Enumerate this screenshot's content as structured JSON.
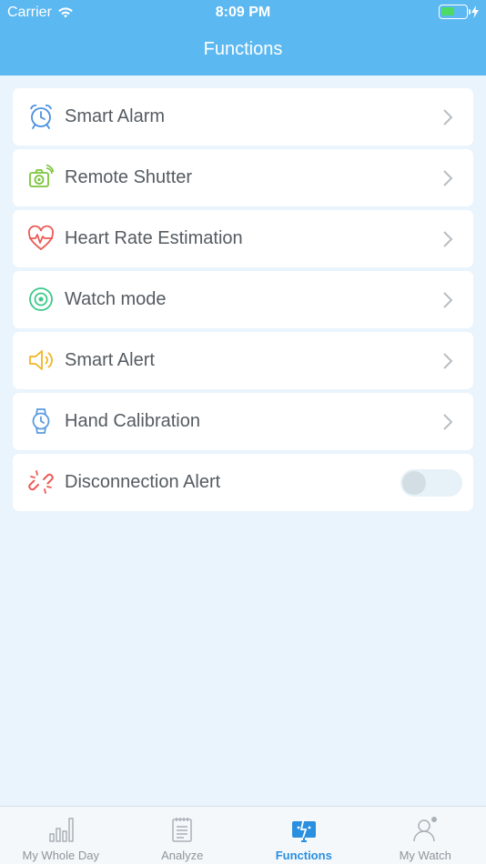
{
  "status_bar": {
    "carrier": "Carrier",
    "time": "8:09 PM",
    "battery_color": "#4cd964"
  },
  "header": {
    "title": "Functions",
    "background": "#5cb8f0"
  },
  "functions": [
    {
      "label": "Smart Alarm",
      "icon": "alarm-clock-icon",
      "color": "#4a8fe0",
      "control": "chevron"
    },
    {
      "label": "Remote Shutter",
      "icon": "camera-icon",
      "color": "#7cc43b",
      "control": "chevron"
    },
    {
      "label": "Heart Rate Estimation",
      "icon": "heart-rate-icon",
      "color": "#ec5a55",
      "control": "chevron"
    },
    {
      "label": "Watch mode",
      "icon": "watch-mode-icon",
      "color": "#3cc98a",
      "control": "chevron"
    },
    {
      "label": "Smart Alert",
      "icon": "speaker-icon",
      "color": "#f2b521",
      "control": "chevron"
    },
    {
      "label": "Hand Calibration",
      "icon": "watch-icon",
      "color": "#5a9be0",
      "control": "chevron"
    },
    {
      "label": "Disconnection Alert",
      "icon": "broken-link-icon",
      "color": "#ec5a55",
      "control": "toggle",
      "toggle_on": false
    }
  ],
  "tabbar": {
    "tabs": [
      {
        "label": "My Whole Day",
        "icon": "bar-chart-icon",
        "active": false
      },
      {
        "label": "Analyze",
        "icon": "notepad-icon",
        "active": false
      },
      {
        "label": "Functions",
        "icon": "functions-icon",
        "active": true
      },
      {
        "label": "My Watch",
        "icon": "person-icon",
        "active": false
      }
    ],
    "active_color": "#2b8fe0"
  }
}
